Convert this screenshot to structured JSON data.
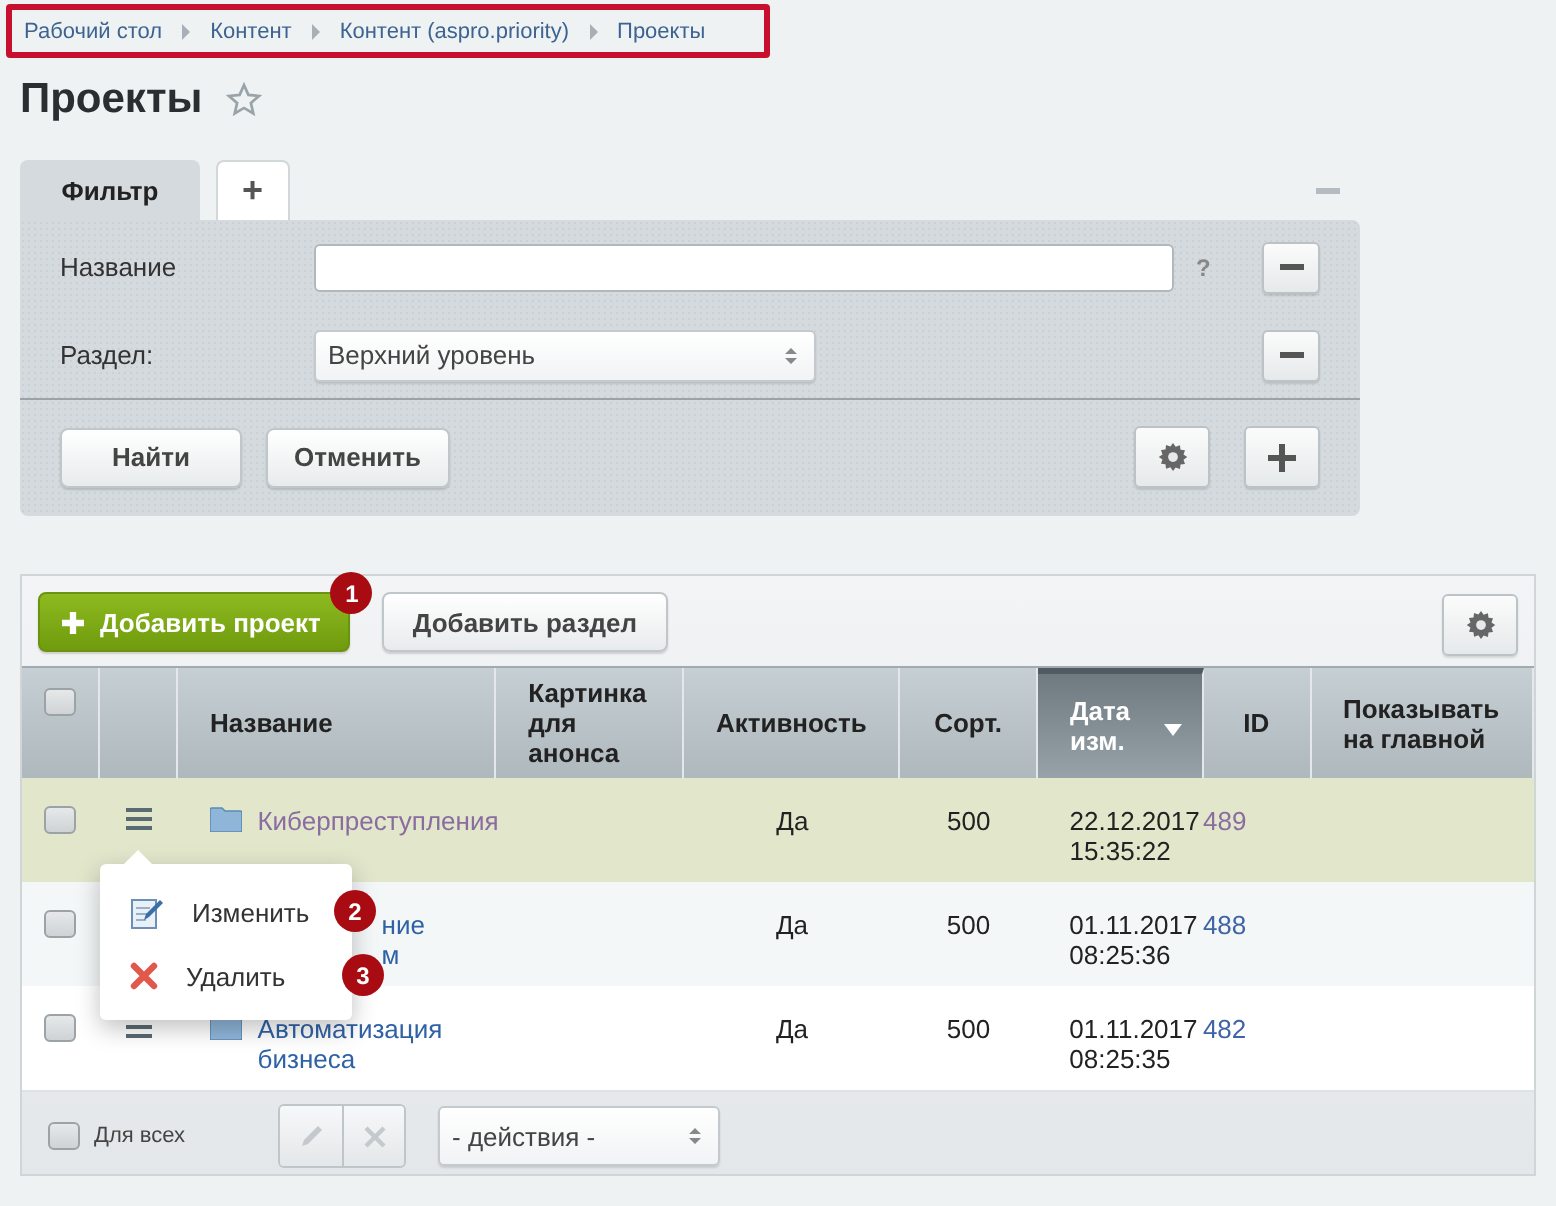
{
  "breadcrumbs": [
    {
      "label": "Рабочий стол"
    },
    {
      "label": "Контент"
    },
    {
      "label": "Контент (aspro.priority)"
    },
    {
      "label": "Проекты"
    }
  ],
  "title": "Проекты",
  "favorite": false,
  "filter": {
    "tabs": [
      {
        "label": "Фильтр",
        "selected": true
      },
      {
        "label": "+",
        "selected": false
      }
    ],
    "fields": [
      {
        "kind": "text",
        "label": "Название",
        "help": "?"
      },
      {
        "kind": "select",
        "label": "Раздел:",
        "value": "Верхний уровень"
      }
    ],
    "buttons": [
      "Найти",
      "Отменить"
    ]
  },
  "toolbar": {
    "buttons": [
      {
        "label": "Добавить проект",
        "kind": "primary",
        "badge": "1"
      },
      {
        "label": "Добавить раздел",
        "kind": "default"
      }
    ]
  },
  "table": {
    "all_checked": false,
    "columns": [
      {
        "kind": "checkbox"
      },
      {
        "kind": "menu"
      },
      {
        "label": "Название",
        "sorted": false
      },
      {
        "label": "Картинка для анонса",
        "sorted": false
      },
      {
        "label": "Активность",
        "sorted": false
      },
      {
        "label": "Сорт.",
        "sorted": false
      },
      {
        "label": "Дата изм.",
        "sorted": true
      },
      {
        "label": "ID",
        "sorted": false
      },
      {
        "label": "Показывать на главной",
        "sorted": false
      }
    ],
    "rows": [
      {
        "checked": false,
        "highlighted": true,
        "covered": false,
        "visited": true,
        "name": "Киберпреступления",
        "active": "Да",
        "sort": "500",
        "date": "22.12.2017",
        "time": "15:35:22",
        "id": "489"
      },
      {
        "checked": false,
        "highlighted": false,
        "covered": true,
        "visited": false,
        "name": "ние м",
        "active": "Да",
        "sort": "500",
        "date": "01.11.2017",
        "time": "08:25:36",
        "id": "488"
      },
      {
        "checked": false,
        "highlighted": false,
        "covered": false,
        "visited": false,
        "name": "Автоматизация бизнеса",
        "active": "Да",
        "sort": "500",
        "date": "01.11.2017",
        "time": "08:25:35",
        "id": "482"
      }
    ]
  },
  "context_menu": {
    "items": [
      {
        "label": "Изменить",
        "kind": "edit",
        "badge": "2"
      },
      {
        "label": "Удалить",
        "kind": "delete",
        "badge": "3"
      }
    ]
  },
  "footer": {
    "checked": false,
    "label": "Для всех",
    "action_select": "- действия -"
  }
}
